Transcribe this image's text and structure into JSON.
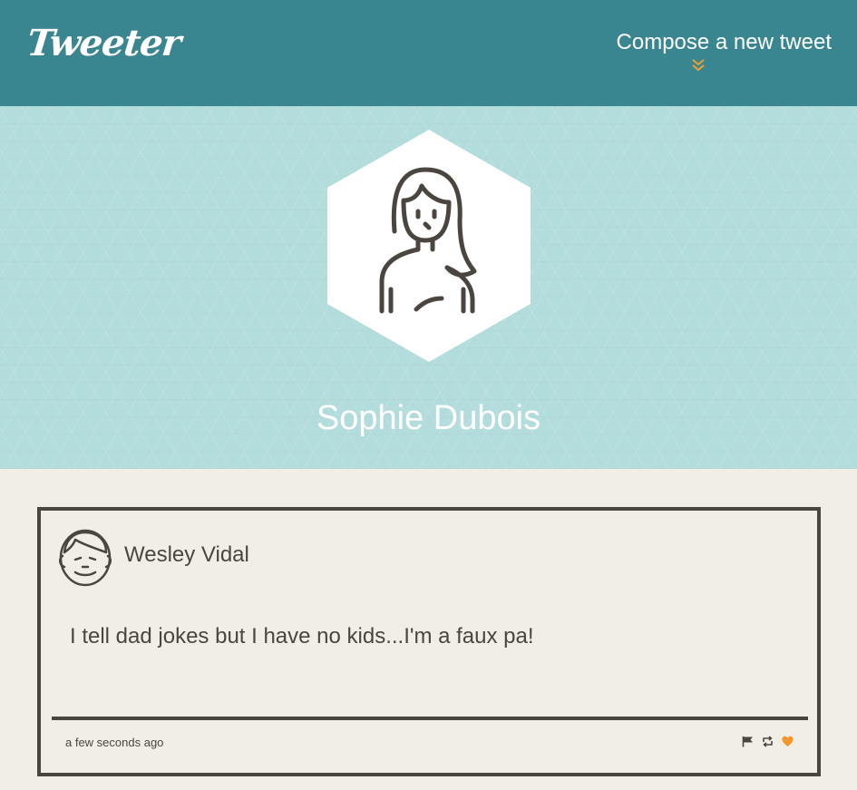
{
  "nav": {
    "logo": "Tweeter",
    "compose_label": "Compose a new tweet",
    "compose_icon": "double-chevron-down-icon",
    "background": "#3a8690",
    "accent": "#f0a030"
  },
  "profile": {
    "name": "Sophie Dubois",
    "avatar_icon": "woman-avatar-icon",
    "banner_color": "#b3dddc"
  },
  "tweets": [
    {
      "author": "Wesley Vidal",
      "avatar_icon": "man-avatar-icon",
      "text": "I tell dad jokes but I have no kids...I'm a faux pa!",
      "time": "a few seconds ago",
      "actions": [
        {
          "icon": "flag-icon",
          "label": "Flag"
        },
        {
          "icon": "retweet-icon",
          "label": "Retweet"
        },
        {
          "icon": "heart-icon",
          "label": "Like",
          "color": "#f5952a"
        }
      ]
    }
  ],
  "colors": {
    "page_bg": "#f1eee8",
    "text_dark": "#4a463f"
  }
}
